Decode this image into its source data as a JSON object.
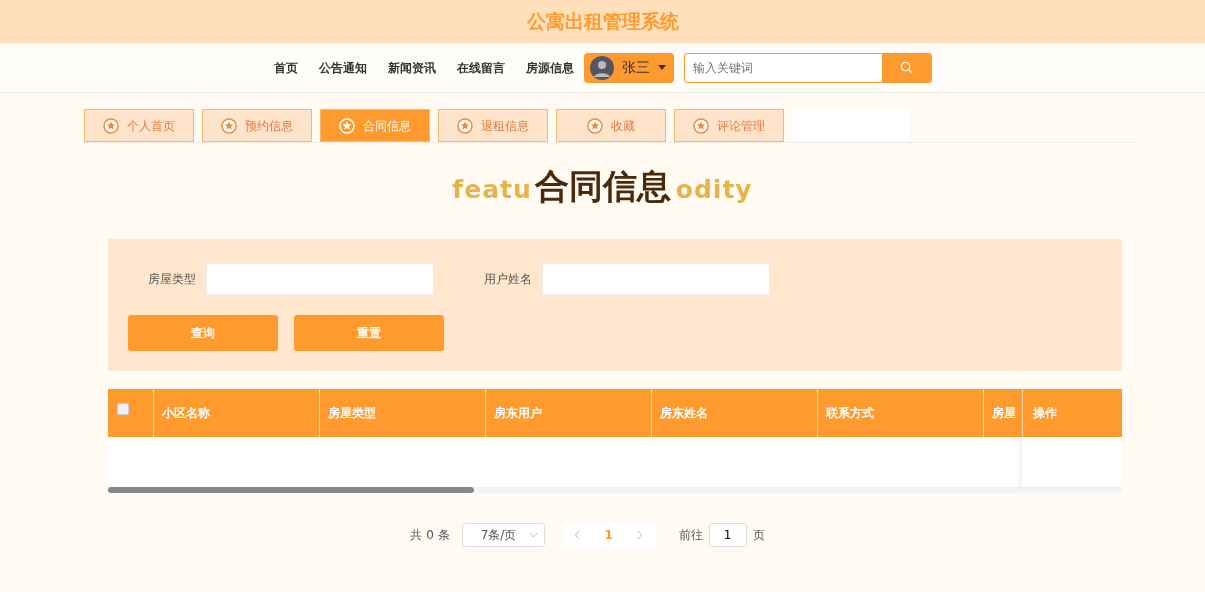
{
  "site_title": "公寓出租管理系统",
  "nav": {
    "links": [
      "首页",
      "公告通知",
      "新闻资讯",
      "在线留言",
      "房源信息"
    ],
    "user": {
      "name": "张三"
    },
    "search": {
      "placeholder": "输入关键词"
    }
  },
  "tabs": [
    {
      "label": "个人首页",
      "selected": false
    },
    {
      "label": "预约信息",
      "selected": false
    },
    {
      "label": "合同信息",
      "selected": true
    },
    {
      "label": "退租信息",
      "selected": false
    },
    {
      "label": "收藏",
      "selected": false
    },
    {
      "label": "评论管理",
      "selected": false
    }
  ],
  "page_title": {
    "text": "合同信息",
    "ghost_left": "featu",
    "ghost_right": "odity"
  },
  "filters": [
    {
      "label": "房屋类型"
    },
    {
      "label": "用户姓名"
    }
  ],
  "filter_buttons": [
    "查询",
    "重置"
  ],
  "table": {
    "select_all": {
      "checked": false
    },
    "columns": [
      "小区名称",
      "房屋类型",
      "房东用户",
      "房东姓名",
      "联系方式",
      "房屋"
    ],
    "fixed_column": "操作"
  },
  "pagination": {
    "total": "共 0 条",
    "page_size": "7条/页",
    "pages": [
      {
        "label": "1",
        "selected": true
      }
    ],
    "goto_label": "前往",
    "goto_value": "1",
    "goto_suffix": "页"
  }
}
